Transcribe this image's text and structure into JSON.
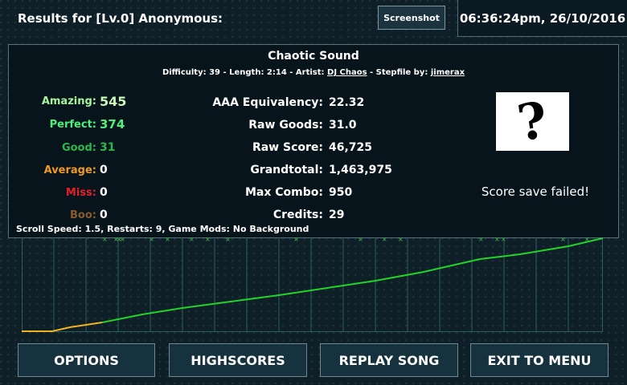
{
  "header": {
    "results_title": "Results for [Lv.0] Anonymous:",
    "screenshot_label": "Screenshot",
    "datetime": "06:36:24pm, 26/10/2016"
  },
  "song": {
    "title": "Chaotic Sound",
    "difficulty_prefix": "Difficulty: 39 - Length: 2:14 - Artist: ",
    "artist": "DJ Chaos",
    "stepfile_prefix": " - Stepfile by: ",
    "stepfile_by": "jimerax"
  },
  "judgements": [
    {
      "label": "Amazing:",
      "value": "545",
      "color": "#a6f59a"
    },
    {
      "label": "Perfect:",
      "value": "374",
      "color": "#4cf07a"
    },
    {
      "label": "Good:",
      "value": "31",
      "color": "#2ab84b"
    },
    {
      "label": "Average:",
      "value": "0",
      "color": "#f09a24"
    },
    {
      "label": "Miss:",
      "value": "0",
      "color": "#e2202a"
    },
    {
      "label": "Boo:",
      "value": "0",
      "color": "#8a5a2b"
    }
  ],
  "stats": [
    {
      "label": "AAA Equivalency:",
      "value": "22.32"
    },
    {
      "label": "Raw Goods:",
      "value": "31.0"
    },
    {
      "label": "Raw Score:",
      "value": "46,725"
    },
    {
      "label": "Grandtotal:",
      "value": "1,463,975"
    },
    {
      "label": "Max Combo:",
      "value": "950"
    },
    {
      "label": "Credits:",
      "value": "29"
    }
  ],
  "avatar_icon": "question-mark-icon",
  "save_message": "Score save failed!",
  "mods_line": "Scroll Speed: 1.5, Restarts: 9, Game Mods: No Background",
  "graph_colors": {
    "progress": "#22d42a",
    "start": "#f2b21f",
    "marks": "#3fbf3f",
    "grid": "#2b5f5a"
  },
  "buttons": {
    "options": "OPTIONS",
    "highscores": "HIGHSCORES",
    "replay": "REPLAY SONG",
    "exit": "EXIT TO MENU"
  }
}
